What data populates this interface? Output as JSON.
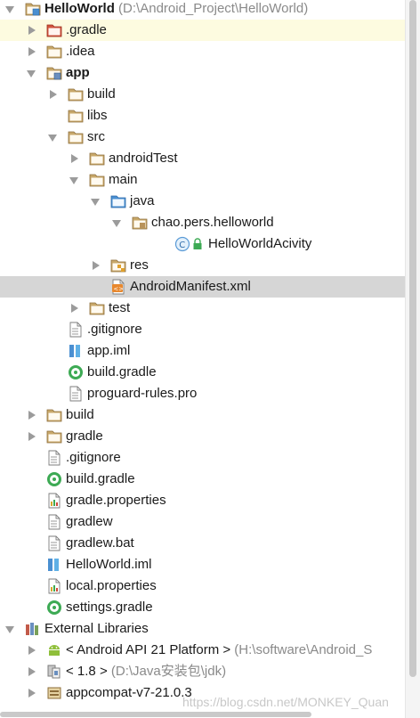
{
  "project_tree": {
    "rows": [
      {
        "label": "HelloWorld",
        "path": "(D:\\Android_Project\\HelloWorld)",
        "bold": true,
        "arrow": "down",
        "icon": "project-module-icon",
        "indent": 0,
        "style": ""
      },
      {
        "label": ".gradle",
        "arrow": "right",
        "icon": "folder-red-icon",
        "indent": 1,
        "style": "sel-light"
      },
      {
        "label": ".idea",
        "arrow": "right",
        "icon": "folder-icon",
        "indent": 1,
        "style": ""
      },
      {
        "label": "app",
        "bold": true,
        "arrow": "down",
        "icon": "module-folder-icon",
        "indent": 1,
        "style": ""
      },
      {
        "label": "build",
        "arrow": "right",
        "icon": "folder-icon",
        "indent": 2,
        "style": ""
      },
      {
        "label": "libs",
        "arrow": "",
        "icon": "folder-icon",
        "indent": 2,
        "style": ""
      },
      {
        "label": "src",
        "arrow": "down",
        "icon": "folder-icon",
        "indent": 2,
        "style": ""
      },
      {
        "label": "androidTest",
        "arrow": "right",
        "icon": "folder-icon",
        "indent": 3,
        "style": ""
      },
      {
        "label": "main",
        "arrow": "down",
        "icon": "folder-icon",
        "indent": 3,
        "style": ""
      },
      {
        "label": "java",
        "arrow": "down",
        "icon": "folder-blue-icon",
        "indent": 4,
        "style": ""
      },
      {
        "label": "chao.pers.helloworld",
        "arrow": "down",
        "icon": "package-icon",
        "indent": 5,
        "style": ""
      },
      {
        "label": "HelloWorldAcivity",
        "arrow": "",
        "icon": "java-class-icon",
        "indent": 7,
        "style": ""
      },
      {
        "label": "res",
        "arrow": "right",
        "icon": "res-folder-icon",
        "indent": 4,
        "style": ""
      },
      {
        "label": "AndroidManifest.xml",
        "arrow": "",
        "icon": "xml-file-icon",
        "indent": 4,
        "style": "sel"
      },
      {
        "label": "test",
        "arrow": "right",
        "icon": "folder-icon",
        "indent": 3,
        "style": ""
      },
      {
        "label": ".gitignore",
        "arrow": "",
        "icon": "text-file-icon",
        "indent": 2,
        "style": ""
      },
      {
        "label": "app.iml",
        "arrow": "",
        "icon": "iml-file-icon",
        "indent": 2,
        "style": ""
      },
      {
        "label": "build.gradle",
        "arrow": "",
        "icon": "gradle-file-icon",
        "indent": 2,
        "style": ""
      },
      {
        "label": "proguard-rules.pro",
        "arrow": "",
        "icon": "text-file-icon",
        "indent": 2,
        "style": ""
      },
      {
        "label": "build",
        "arrow": "right",
        "icon": "folder-icon",
        "indent": 1,
        "style": ""
      },
      {
        "label": "gradle",
        "arrow": "right",
        "icon": "folder-icon",
        "indent": 1,
        "style": ""
      },
      {
        "label": ".gitignore",
        "arrow": "",
        "icon": "text-file-icon",
        "indent": 1,
        "style": ""
      },
      {
        "label": "build.gradle",
        "arrow": "",
        "icon": "gradle-file-icon",
        "indent": 1,
        "style": ""
      },
      {
        "label": "gradle.properties",
        "arrow": "",
        "icon": "properties-file-icon",
        "indent": 1,
        "style": ""
      },
      {
        "label": "gradlew",
        "arrow": "",
        "icon": "text-file-icon",
        "indent": 1,
        "style": ""
      },
      {
        "label": "gradlew.bat",
        "arrow": "",
        "icon": "text-file-icon",
        "indent": 1,
        "style": ""
      },
      {
        "label": "HelloWorld.iml",
        "arrow": "",
        "icon": "iml-file-icon",
        "indent": 1,
        "style": ""
      },
      {
        "label": "local.properties",
        "arrow": "",
        "icon": "properties-file-icon",
        "indent": 1,
        "style": ""
      },
      {
        "label": "settings.gradle",
        "arrow": "",
        "icon": "gradle-file-icon",
        "indent": 1,
        "style": ""
      },
      {
        "label": "External Libraries",
        "arrow": "down",
        "icon": "libraries-icon",
        "indent": 0,
        "style": ""
      },
      {
        "label": "< Android API 21 Platform >",
        "path": "(H:\\software\\Android_S",
        "arrow": "right",
        "icon": "android-icon",
        "indent": 1,
        "style": ""
      },
      {
        "label": "< 1.8 >",
        "path": "(D:\\Java安装包\\jdk)",
        "arrow": "right",
        "icon": "jdk-icon",
        "indent": 1,
        "style": ""
      },
      {
        "label": "appcompat-v7-21.0.3",
        "arrow": "right",
        "icon": "library-icon",
        "indent": 1,
        "style": ""
      }
    ]
  },
  "watermark": "https://blog.csdn.net/MONKEY_Quan",
  "colors": {
    "folder": "#c8a86a",
    "folder_red": "#d2553f",
    "folder_blue": "#4a8fd1",
    "gradle_green": "#3daa54",
    "class_blue": "#5a9ad6",
    "selection": "#d6d6d6"
  }
}
